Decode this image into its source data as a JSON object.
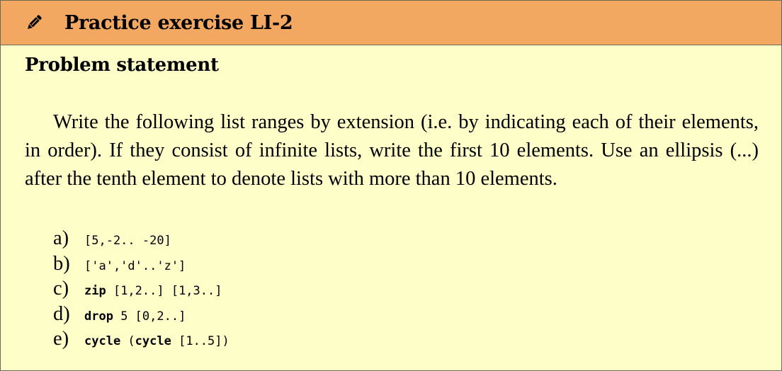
{
  "header": {
    "icon": "pencil-icon",
    "title": "Practice exercise LI-2",
    "background": "#f2a860"
  },
  "section": {
    "title": "Problem statement"
  },
  "statement": "Write the following list ranges by extension (i.e. by indicating each of their elements, in order). If they consist of infinite lists, write the first 10 elements. Use an ellipsis (...) after the tenth element to denote lists with more than 10 elements.",
  "items": [
    {
      "label": "a)",
      "keyword": "",
      "code": "[5,-2.. -20]"
    },
    {
      "label": "b)",
      "keyword": "",
      "code": "['a','d'..'z']"
    },
    {
      "label": "c)",
      "keyword": "zip",
      "code": " [1,2..] [1,3..]"
    },
    {
      "label": "d)",
      "keyword": "drop",
      "code": " 5 [0,2..]"
    },
    {
      "label": "e)",
      "keyword": "cycle",
      "code": " (",
      "keyword2": "cycle",
      "code2": " [1..5])"
    }
  ],
  "colors": {
    "body_background": "#fefec8",
    "border": "#6b6b55"
  }
}
